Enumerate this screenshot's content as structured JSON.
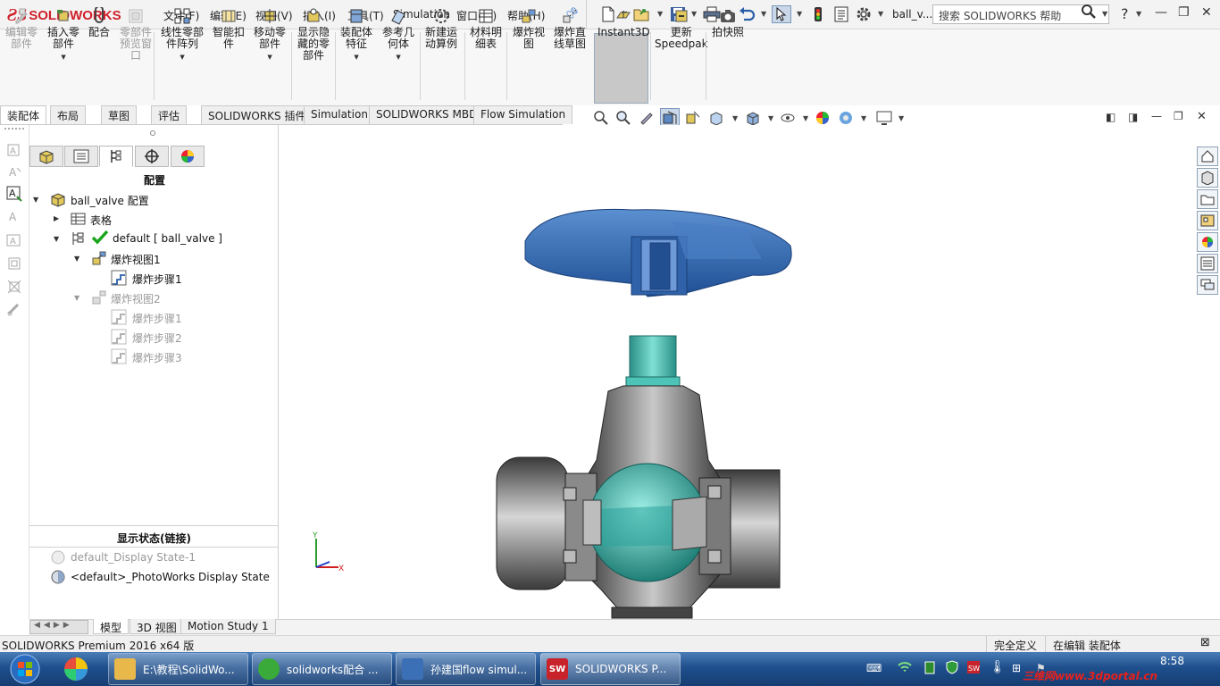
{
  "titlebar": {
    "logo_ds": "ƧS",
    "logo_text": "SOLIDWORKS",
    "menus": [
      "文件(F)",
      "编辑(E)",
      "视图(V)",
      "插入(I)",
      "工具(T)",
      "Simulation",
      "窗口(W)",
      "帮助(H)"
    ],
    "doc_name": "ball_v...",
    "search_placeholder": "搜索 SOLIDWORKS 帮助"
  },
  "commands": [
    {
      "label": "编辑零\n部件",
      "disabled": true,
      "icon": "edit-component-icon"
    },
    {
      "label": "插入零\n部件",
      "disabled": false,
      "icon": "insert-component-icon"
    },
    {
      "label": "配合",
      "disabled": false,
      "icon": "mate-icon"
    },
    {
      "label": "零部件\n预览窗\n口",
      "disabled": true,
      "icon": "preview-window-icon"
    },
    {
      "label": "线性零部\n件阵列",
      "disabled": false,
      "icon": "linear-pattern-icon"
    },
    {
      "label": "智能扣\n件",
      "disabled": false,
      "icon": "smart-fasteners-icon"
    },
    {
      "label": "移动零\n部件",
      "disabled": false,
      "icon": "move-component-icon"
    },
    {
      "label": "显示隐\n藏的零\n部件",
      "disabled": false,
      "icon": "show-hidden-icon"
    },
    {
      "label": "装配体\n特征",
      "disabled": false,
      "icon": "assembly-features-icon"
    },
    {
      "label": "参考几\n何体",
      "disabled": false,
      "icon": "reference-geometry-icon"
    },
    {
      "label": "新建运\n动算例",
      "disabled": false,
      "icon": "new-motion-study-icon"
    },
    {
      "label": "材料明\n细表",
      "disabled": false,
      "icon": "bom-icon"
    },
    {
      "label": "爆炸视\n图",
      "disabled": false,
      "icon": "exploded-view-icon"
    },
    {
      "label": "爆炸直\n线草图",
      "disabled": false,
      "icon": "explode-line-sketch-icon"
    },
    {
      "label": "Instant3D",
      "disabled": false,
      "icon": "instant3d-icon"
    },
    {
      "label": "更新\nSpeedpak",
      "disabled": false,
      "icon": "speedpak-icon"
    },
    {
      "label": "拍快照",
      "disabled": false,
      "icon": "snapshot-icon"
    }
  ],
  "tabs": [
    "装配体",
    "布局",
    "草图",
    "评估",
    "SOLIDWORKS 插件",
    "Simulation",
    "SOLIDWORKS MBD",
    "Flow Simulation"
  ],
  "feature_manager": {
    "title": "配置",
    "root": "ball_valve 配置",
    "tables": "表格",
    "default_config": "default [ ball_valve ]",
    "explode1": "爆炸视图1",
    "explode1_steps": [
      "爆炸步骤1"
    ],
    "explode2": "爆炸视图2",
    "explode2_steps": [
      "爆炸步骤1",
      "爆炸步骤2",
      "爆炸步骤3"
    ],
    "display_state_title": "显示状态(链接)",
    "display_states": [
      "default_Display State-1",
      "<default>_PhotoWorks Display State"
    ]
  },
  "bottom_tabs": [
    "模型",
    "3D 视图",
    "Motion Study 1"
  ],
  "status": {
    "left": "SOLIDWORKS Premium 2016 x64 版",
    "fully_defined": "完全定义",
    "editing": "在编辑 装配体"
  },
  "taskbar": {
    "items": [
      {
        "label": "E:\\教程\\SolidWo...",
        "color": "#e8b84a"
      },
      {
        "label": "solidworks配合 ...",
        "color": "#3aaa3a"
      },
      {
        "label": "孙建国flow simul...",
        "color": "#3b6fb6"
      },
      {
        "label": "SOLIDWORKS P...",
        "color": "#c8232a"
      }
    ],
    "clock": "8:58",
    "watermark": "三维网www.3dportal.cn"
  },
  "colors": {
    "handle": "#3a6fb2",
    "ball": "#2aa39a",
    "body": "#6b6b6b",
    "accent_red": "#d0202a"
  }
}
